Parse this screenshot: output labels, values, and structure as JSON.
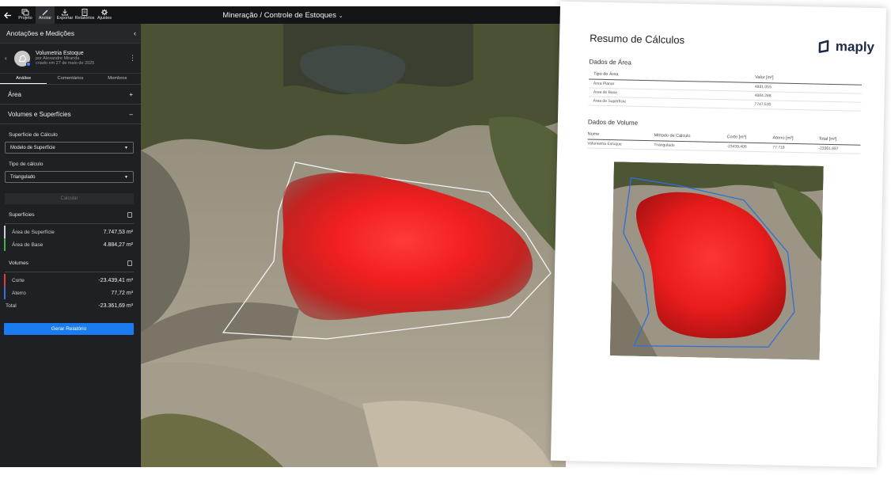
{
  "toolbar": {
    "nav": [
      {
        "label": "Projeto",
        "icon": "project-icon"
      },
      {
        "label": "Anotar",
        "icon": "annotate-icon"
      },
      {
        "label": "Exportar",
        "icon": "export-icon"
      },
      {
        "label": "Relatórios",
        "icon": "reports-icon"
      },
      {
        "label": "Ajustes",
        "icon": "settings-icon"
      }
    ],
    "title": "Mineração / Controle de Estoques"
  },
  "sidebar": {
    "header": "Anotações e Medições",
    "document": {
      "title": "Volumetria Estoque",
      "author": "por  Alexandre Miranda",
      "created": "criado em 27 de maio de 2025"
    },
    "tabs": [
      {
        "label": "Análise",
        "active": true
      },
      {
        "label": "Comentários",
        "active": false
      },
      {
        "label": "Membros",
        "active": false
      }
    ],
    "sections": {
      "area": {
        "label": "Área",
        "toggle": "+"
      },
      "volumes": {
        "label": "Volumes e Superfícies",
        "toggle": "–"
      }
    },
    "calc_surface": {
      "label": "Superfície de Cálculo",
      "value": "Modelo de Superfície"
    },
    "calc_type": {
      "label": "Tipo de cálculo",
      "value": "Triangulado"
    },
    "calc_button": "Calcular",
    "surfaces": {
      "label": "Superfícies",
      "rows": [
        {
          "name": "Área de Superfície",
          "value": "7.747,53 m²",
          "color": "#cfcfcf"
        },
        {
          "name": "Área de Base",
          "value": "4.884,27 m²",
          "color": "#43b04a"
        }
      ]
    },
    "volumes": {
      "label": "Volumes",
      "rows": [
        {
          "name": "Corte",
          "value": "-23.439,41 m³",
          "color": "#e0413a"
        },
        {
          "name": "Aterro",
          "value": "77,72 m³",
          "color": "#3b6fe0"
        }
      ],
      "total_label": "Total",
      "total_value": "-23.361,69 m³"
    },
    "report_button": "Gerar Relatório"
  },
  "report": {
    "title": "Resumo de Cálculos",
    "logo": "maply",
    "area": {
      "title": "Dados de Área",
      "headers": [
        "Tipo de Área",
        "Valor [m²]"
      ],
      "rows": [
        [
          "Área Planar",
          "4881.055"
        ],
        [
          "Área de Base",
          "4884.268"
        ],
        [
          "Área de Superfície",
          "7747.530"
        ]
      ]
    },
    "volume": {
      "title": "Dados de Volume",
      "headers": [
        "Nome",
        "Método de Cálculo",
        "Corte [m³]",
        "Aterro [m³]",
        "Total [m³]"
      ],
      "rows": [
        [
          "Volumetria Estoque",
          "Triangulado",
          "-23439.406",
          "77.718",
          "-23361.687"
        ]
      ]
    }
  },
  "colors": {
    "accent": "#1b7bf0",
    "cut": "#e0413a",
    "fill": "#3b6fe0",
    "base": "#43b04a"
  }
}
